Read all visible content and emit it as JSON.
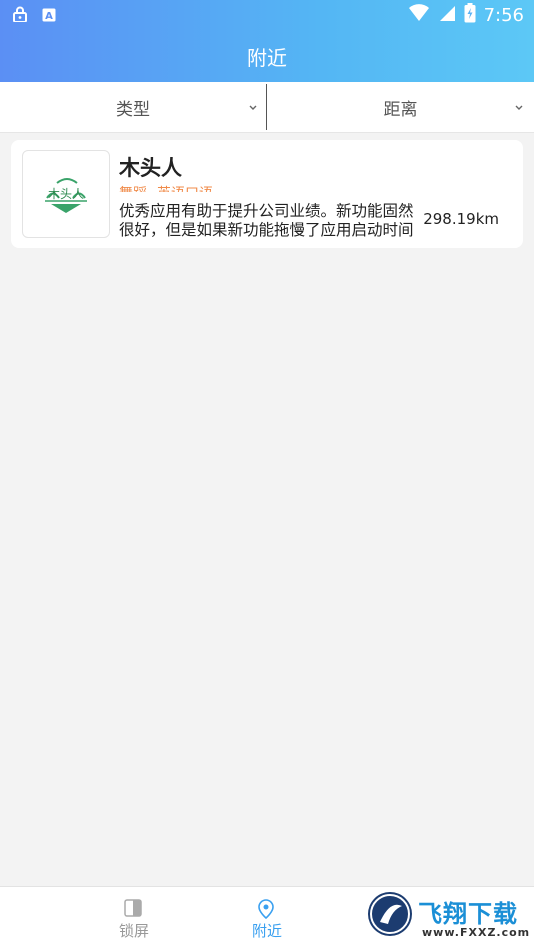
{
  "status_bar": {
    "time": "7:56"
  },
  "header": {
    "title": "附近"
  },
  "filters": [
    {
      "label": "类型"
    },
    {
      "label": "距离"
    }
  ],
  "list": [
    {
      "name": "木头人",
      "logo_text": "木头人",
      "tags": [
        "舞蹈",
        "英语口语"
      ],
      "description": "优秀应用有助于提升公司业绩。新功能固然很好，但是如果新功能拖慢了应用启动时间",
      "distance": "298.19km"
    }
  ],
  "tabbar": {
    "tabs": [
      {
        "label": "锁屏"
      },
      {
        "label": "附近"
      }
    ]
  },
  "watermark": {
    "brand": "飞翔下载",
    "url": "www.FXXZ.com"
  },
  "colors": {
    "accent": "#3aa0f0",
    "tag": "#f08b4a",
    "header_start": "#5b8ff4",
    "header_end": "#5cc8f6"
  }
}
